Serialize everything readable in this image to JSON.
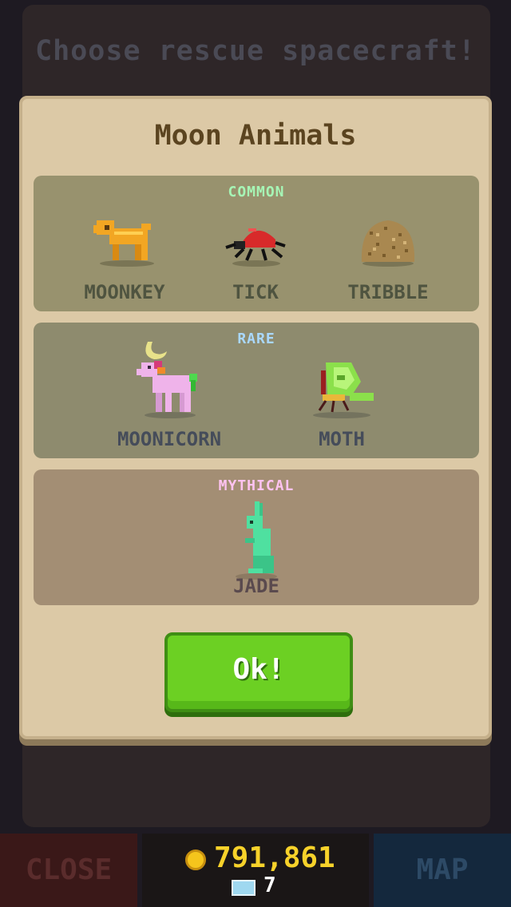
{
  "background": {
    "title": "Choose rescue spacecraft!"
  },
  "modal": {
    "title": "Moon Animals",
    "sections": [
      {
        "label": "COMMON",
        "label_color": "#a6f5b5",
        "animals": [
          "MOONKEY",
          "TICK",
          "TRIBBLE"
        ]
      },
      {
        "label": "RARE",
        "label_color": "#a9d8ff",
        "animals": [
          "MOONICORN",
          "MOTH"
        ]
      },
      {
        "label": "MYTHICAL",
        "label_color": "#ffc3f1",
        "animals": [
          "JADE"
        ]
      }
    ],
    "ok_label": "Ok!"
  },
  "bottom_bar": {
    "close_label": "CLOSE",
    "map_label": "MAP",
    "coins": "791,861",
    "gems": "7"
  },
  "icons": {
    "coin": "coin-icon",
    "gem": "diamond-icon"
  }
}
